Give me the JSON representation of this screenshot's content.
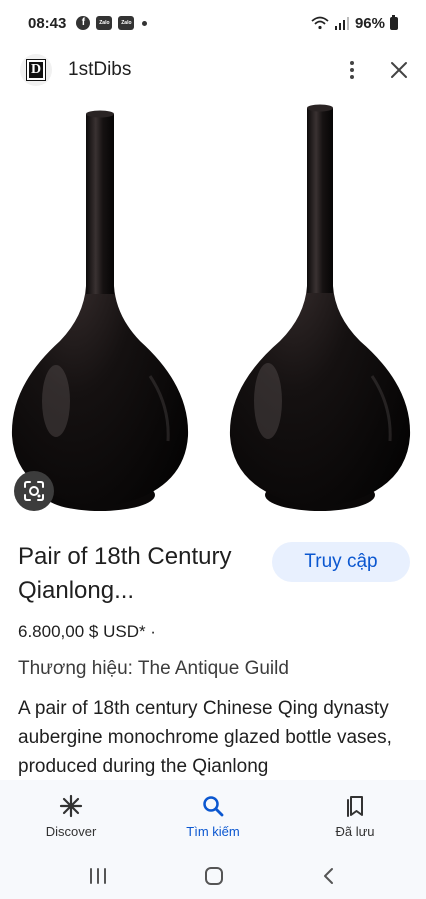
{
  "status_bar": {
    "time": "08:43",
    "battery": "96%",
    "notif_icons": [
      "facebook-icon",
      "zalo-icon",
      "zalo-icon"
    ],
    "zalo_label": "Zalo"
  },
  "header": {
    "site_name": "1stDibs",
    "favicon_letter": "D"
  },
  "product": {
    "title": "Pair of 18th Century Qianlong...",
    "visit_label": "Truy cập",
    "price": "6.800,00 $ USD* ·",
    "brand": "Thương hiệu: The Antique Guild",
    "description": "A pair of 18th century Chinese Qing dynasty aubergine monochrome glazed bottle vases, produced during the Qianlong"
  },
  "bottom_nav": {
    "items": [
      {
        "label": "Discover",
        "icon": "asterisk-icon",
        "active": false
      },
      {
        "label": "Tìm kiếm",
        "icon": "search-icon",
        "active": true
      },
      {
        "label": "Đã lưu",
        "icon": "bookmarks-icon",
        "active": false
      }
    ]
  },
  "colors": {
    "accent": "#0b57d0",
    "visit_button_bg": "#e8f0fe",
    "vase_glaze": "#141010"
  }
}
